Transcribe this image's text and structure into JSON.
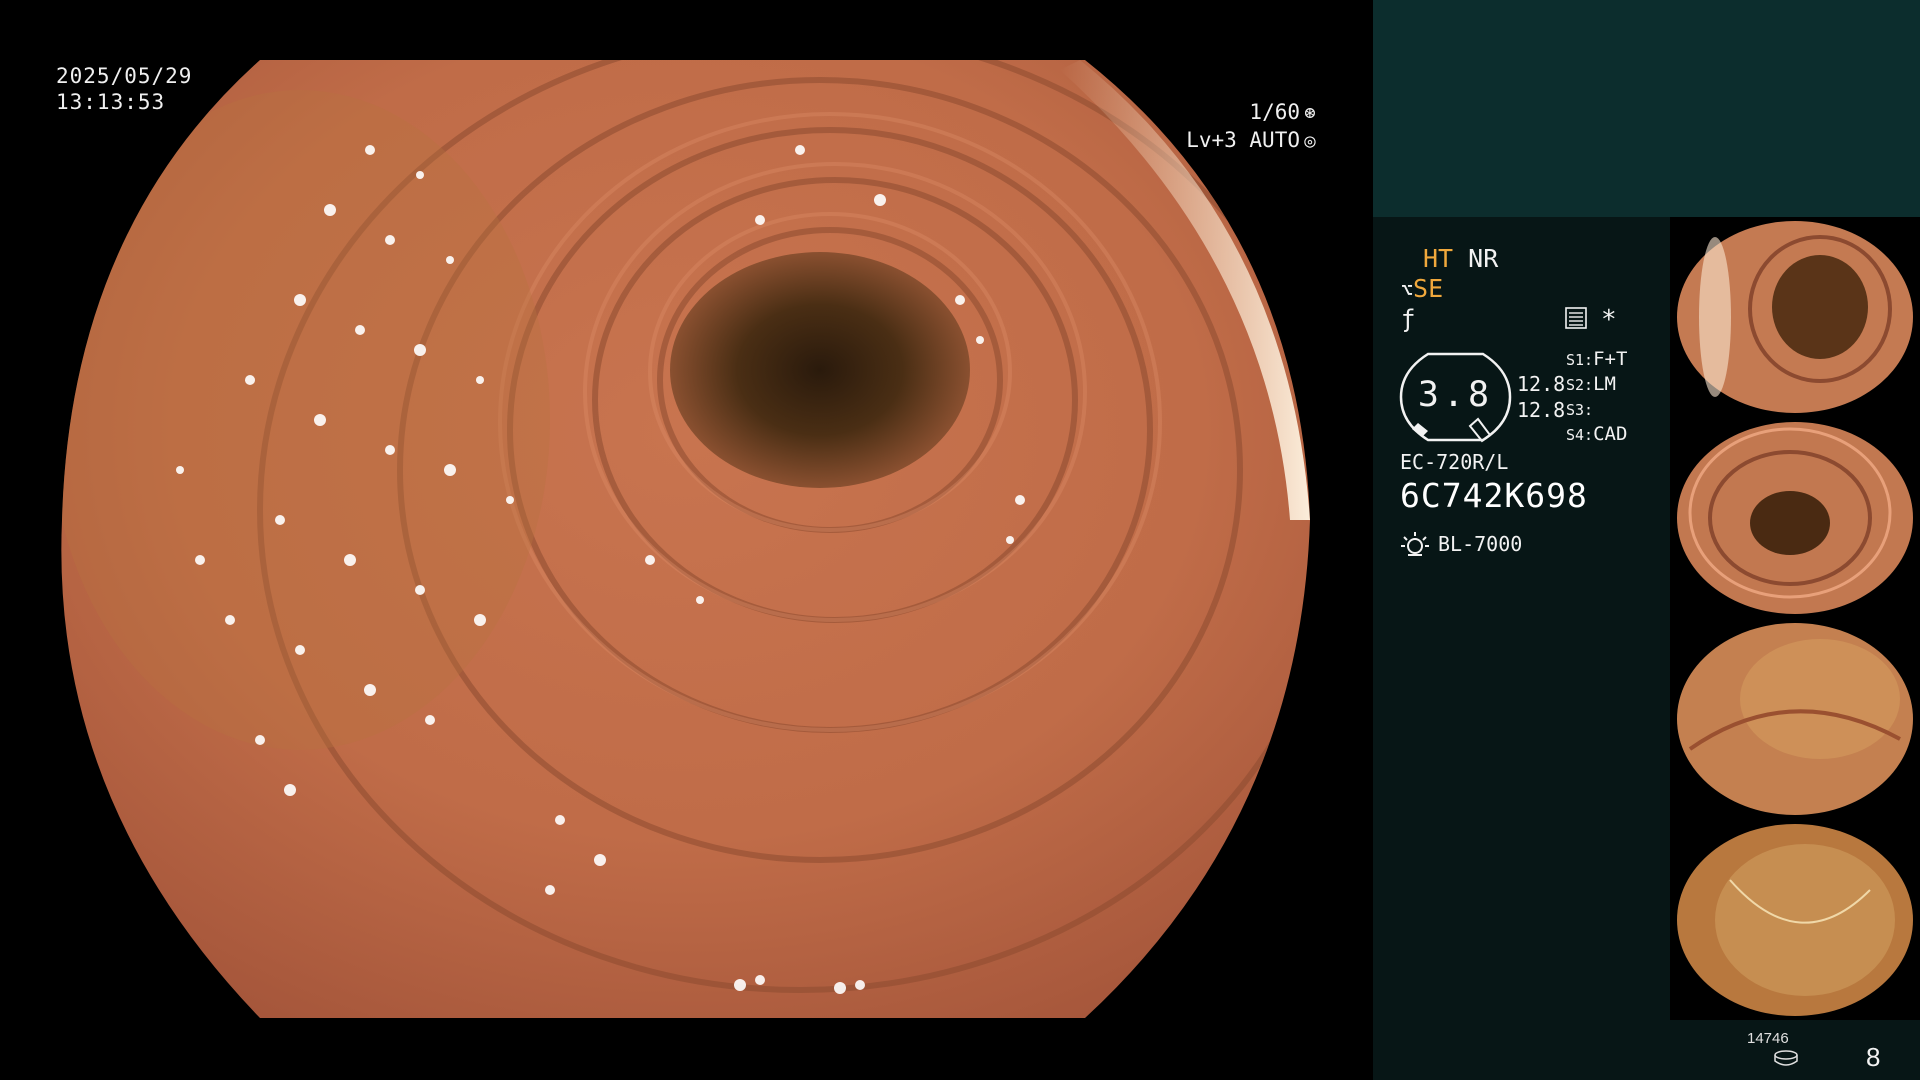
{
  "overlay": {
    "date": "2025/05/29",
    "time": "13:13:53",
    "shutter": "1/60",
    "shutter_icon": "shutter-icon",
    "iris": "Lv+3 AUTO",
    "iris_icon": "iris-auto-icon"
  },
  "status": {
    "ht": "HT",
    "nr": "NR",
    "se": "SE",
    "se_icon": "structure-enhance-icon",
    "f_icon": "f-mark-icon",
    "menu_icon": "menu-list-icon",
    "asterisk": "*"
  },
  "gauge": {
    "value": "3.8",
    "side1": "12.8",
    "side2": "12.8"
  },
  "switches": [
    {
      "key": "S1:",
      "value": "F+T"
    },
    {
      "key": "S2:",
      "value": "LM"
    },
    {
      "key": "S3:",
      "value": ""
    },
    {
      "key": "S4:",
      "value": "CAD"
    }
  ],
  "device": {
    "model": "EC-720R/L",
    "serial": "6C742K698",
    "light_source": "BL-7000",
    "light_icon": "light-source-icon"
  },
  "footer": {
    "image_count": "14746",
    "storage_icon": "storage-disk-icon",
    "page": "8"
  },
  "colors": {
    "accent": "#f0a83c",
    "top_panel": "#0c2d2d",
    "info_panel": "#071616"
  }
}
